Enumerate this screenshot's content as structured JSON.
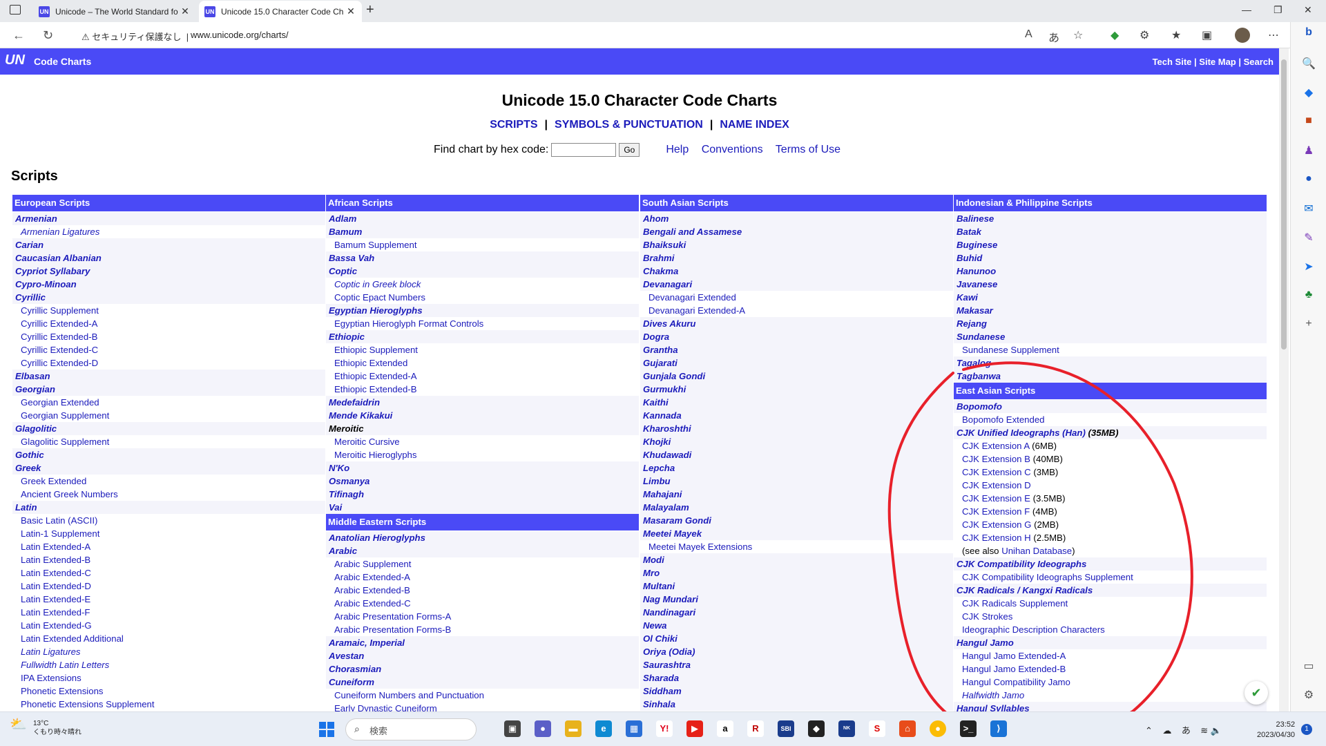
{
  "browser": {
    "tabs": [
      {
        "title": "Unicode – The World Standard fo"
      },
      {
        "title": "Unicode 15.0 Character Code Ch"
      }
    ],
    "security_label": "セキュリティ保護なし",
    "url": "www.unicode.org/charts/"
  },
  "site": {
    "logo": "UN",
    "section": "Code Charts",
    "links": [
      "Tech Site",
      "Site Map",
      "Search"
    ]
  },
  "page": {
    "title": "Unicode 15.0 Character Code Charts",
    "nav": [
      "SCRIPTS",
      "SYMBOLS & PUNCTUATION",
      "NAME INDEX"
    ],
    "find_label": "Find chart by hex code:",
    "go_label": "Go",
    "help_links": [
      "Help",
      "Conventions",
      "Terms of Use"
    ],
    "scripts_heading": "Scripts"
  },
  "columns": [
    {
      "sections": [
        {
          "header": "European Scripts",
          "items": [
            {
              "t": "Armenian",
              "k": "b"
            },
            {
              "t": "Armenian Ligatures",
              "k": "si"
            },
            {
              "t": "Carian",
              "k": "b"
            },
            {
              "t": "Caucasian Albanian",
              "k": "b"
            },
            {
              "t": "Cypriot Syllabary",
              "k": "b"
            },
            {
              "t": "Cypro-Minoan",
              "k": "b"
            },
            {
              "t": "Cyrillic",
              "k": "b"
            },
            {
              "t": "Cyrillic Supplement",
              "k": "s"
            },
            {
              "t": "Cyrillic Extended-A",
              "k": "s"
            },
            {
              "t": "Cyrillic Extended-B",
              "k": "s"
            },
            {
              "t": "Cyrillic Extended-C",
              "k": "s"
            },
            {
              "t": "Cyrillic Extended-D",
              "k": "s"
            },
            {
              "t": "Elbasan",
              "k": "b"
            },
            {
              "t": "Georgian",
              "k": "b"
            },
            {
              "t": "Georgian Extended",
              "k": "s"
            },
            {
              "t": "Georgian Supplement",
              "k": "s"
            },
            {
              "t": "Glagolitic",
              "k": "b"
            },
            {
              "t": "Glagolitic Supplement",
              "k": "s"
            },
            {
              "t": "Gothic",
              "k": "b"
            },
            {
              "t": "Greek",
              "k": "b"
            },
            {
              "t": "Greek Extended",
              "k": "s"
            },
            {
              "t": "Ancient Greek Numbers",
              "k": "s"
            },
            {
              "t": "Latin",
              "k": "b"
            },
            {
              "t": "Basic Latin (ASCII)",
              "k": "s"
            },
            {
              "t": "Latin-1 Supplement",
              "k": "s"
            },
            {
              "t": "Latin Extended-A",
              "k": "s"
            },
            {
              "t": "Latin Extended-B",
              "k": "s"
            },
            {
              "t": "Latin Extended-C",
              "k": "s"
            },
            {
              "t": "Latin Extended-D",
              "k": "s"
            },
            {
              "t": "Latin Extended-E",
              "k": "s"
            },
            {
              "t": "Latin Extended-F",
              "k": "s"
            },
            {
              "t": "Latin Extended-G",
              "k": "s"
            },
            {
              "t": "Latin Extended Additional",
              "k": "s"
            },
            {
              "t": "Latin Ligatures",
              "k": "si"
            },
            {
              "t": "Fullwidth Latin Letters",
              "k": "si"
            },
            {
              "t": "IPA Extensions",
              "k": "s"
            },
            {
              "t": "Phonetic Extensions",
              "k": "s"
            },
            {
              "t": "Phonetic Extensions Supplement",
              "k": "s"
            }
          ]
        }
      ]
    },
    {
      "sections": [
        {
          "header": "African Scripts",
          "items": [
            {
              "t": "Adlam",
              "k": "b"
            },
            {
              "t": "Bamum",
              "k": "b"
            },
            {
              "t": "Bamum Supplement",
              "k": "s"
            },
            {
              "t": "Bassa Vah",
              "k": "b"
            },
            {
              "t": "Coptic",
              "k": "b"
            },
            {
              "t": "Coptic in Greek block",
              "k": "si"
            },
            {
              "t": "Coptic Epact Numbers",
              "k": "s"
            },
            {
              "t": "Egyptian Hieroglyphs",
              "k": "b"
            },
            {
              "t": "Egyptian Hieroglyph Format Controls",
              "k": "s"
            },
            {
              "t": "Ethiopic",
              "k": "b"
            },
            {
              "t": "Ethiopic Supplement",
              "k": "s"
            },
            {
              "t": "Ethiopic Extended",
              "k": "s"
            },
            {
              "t": "Ethiopic Extended-A",
              "k": "s"
            },
            {
              "t": "Ethiopic Extended-B",
              "k": "s"
            },
            {
              "t": "Medefaidrin",
              "k": "b"
            },
            {
              "t": "Mende Kikakui",
              "k": "b"
            },
            {
              "t": "Meroitic",
              "k": "bk"
            },
            {
              "t": "Meroitic Cursive",
              "k": "s"
            },
            {
              "t": "Meroitic Hieroglyphs",
              "k": "s"
            },
            {
              "t": "N'Ko",
              "k": "b"
            },
            {
              "t": "Osmanya",
              "k": "b"
            },
            {
              "t": "Tifinagh",
              "k": "b"
            },
            {
              "t": "Vai",
              "k": "b"
            }
          ]
        },
        {
          "header": "Middle Eastern Scripts",
          "items": [
            {
              "t": "Anatolian Hieroglyphs",
              "k": "b"
            },
            {
              "t": "Arabic",
              "k": "b"
            },
            {
              "t": "Arabic Supplement",
              "k": "s"
            },
            {
              "t": "Arabic Extended-A",
              "k": "s"
            },
            {
              "t": "Arabic Extended-B",
              "k": "s"
            },
            {
              "t": "Arabic Extended-C",
              "k": "s"
            },
            {
              "t": "Arabic Presentation Forms-A",
              "k": "s"
            },
            {
              "t": "Arabic Presentation Forms-B",
              "k": "s"
            },
            {
              "t": "Aramaic, Imperial",
              "k": "b"
            },
            {
              "t": "Avestan",
              "k": "b"
            },
            {
              "t": "Chorasmian",
              "k": "b"
            },
            {
              "t": "Cuneiform",
              "k": "b"
            },
            {
              "t": "Cuneiform Numbers and Punctuation",
              "k": "s"
            },
            {
              "t": "Early Dynastic Cuneiform",
              "k": "s"
            }
          ]
        }
      ]
    },
    {
      "sections": [
        {
          "header": "South Asian Scripts",
          "items": [
            {
              "t": "Ahom",
              "k": "b"
            },
            {
              "t": "Bengali and Assamese",
              "k": "b"
            },
            {
              "t": "Bhaiksuki",
              "k": "b"
            },
            {
              "t": "Brahmi",
              "k": "b"
            },
            {
              "t": "Chakma",
              "k": "b"
            },
            {
              "t": "Devanagari",
              "k": "b"
            },
            {
              "t": "Devanagari Extended",
              "k": "s"
            },
            {
              "t": "Devanagari Extended-A",
              "k": "s"
            },
            {
              "t": "Dives Akuru",
              "k": "b"
            },
            {
              "t": "Dogra",
              "k": "b"
            },
            {
              "t": "Grantha",
              "k": "b"
            },
            {
              "t": "Gujarati",
              "k": "b"
            },
            {
              "t": "Gunjala Gondi",
              "k": "b"
            },
            {
              "t": "Gurmukhi",
              "k": "b"
            },
            {
              "t": "Kaithi",
              "k": "b"
            },
            {
              "t": "Kannada",
              "k": "b"
            },
            {
              "t": "Kharoshthi",
              "k": "b"
            },
            {
              "t": "Khojki",
              "k": "b"
            },
            {
              "t": "Khudawadi",
              "k": "b"
            },
            {
              "t": "Lepcha",
              "k": "b"
            },
            {
              "t": "Limbu",
              "k": "b"
            },
            {
              "t": "Mahajani",
              "k": "b"
            },
            {
              "t": "Malayalam",
              "k": "b"
            },
            {
              "t": "Masaram Gondi",
              "k": "b"
            },
            {
              "t": "Meetei Mayek",
              "k": "b"
            },
            {
              "t": "Meetei Mayek Extensions",
              "k": "s"
            },
            {
              "t": "Modi",
              "k": "b"
            },
            {
              "t": "Mro",
              "k": "b"
            },
            {
              "t": "Multani",
              "k": "b"
            },
            {
              "t": "Nag Mundari",
              "k": "b"
            },
            {
              "t": "Nandinagari",
              "k": "b"
            },
            {
              "t": "Newa",
              "k": "b"
            },
            {
              "t": "Ol Chiki",
              "k": "b"
            },
            {
              "t": "Oriya (Odia)",
              "k": "b"
            },
            {
              "t": "Saurashtra",
              "k": "b"
            },
            {
              "t": "Sharada",
              "k": "b"
            },
            {
              "t": "Siddham",
              "k": "b"
            },
            {
              "t": "Sinhala",
              "k": "b"
            }
          ]
        }
      ]
    },
    {
      "sections": [
        {
          "header": "Indonesian & Philippine Scripts",
          "items": [
            {
              "t": "Balinese",
              "k": "b"
            },
            {
              "t": "Batak",
              "k": "b"
            },
            {
              "t": "Buginese",
              "k": "b"
            },
            {
              "t": "Buhid",
              "k": "b"
            },
            {
              "t": "Hanunoo",
              "k": "b"
            },
            {
              "t": "Javanese",
              "k": "b"
            },
            {
              "t": "Kawi",
              "k": "b"
            },
            {
              "t": "Makasar",
              "k": "b"
            },
            {
              "t": "Rejang",
              "k": "b"
            },
            {
              "t": "Sundanese",
              "k": "b"
            },
            {
              "t": "Sundanese Supplement",
              "k": "s"
            },
            {
              "t": "Tagalog",
              "k": "b"
            },
            {
              "t": "Tagbanwa",
              "k": "b"
            }
          ]
        },
        {
          "header": "East Asian Scripts",
          "items": [
            {
              "t": "Bopomofo",
              "k": "b"
            },
            {
              "t": "Bopomofo Extended",
              "k": "s"
            },
            {
              "t": "CJK Unified Ideographs (Han)",
              "k": "b",
              "extra": " (35MB)"
            },
            {
              "t": "CJK Extension A",
              "k": "s",
              "extra": " (6MB)"
            },
            {
              "t": "CJK Extension B",
              "k": "s",
              "extra": " (40MB)"
            },
            {
              "t": "CJK Extension C",
              "k": "s",
              "extra": " (3MB)"
            },
            {
              "t": "CJK Extension D",
              "k": "s"
            },
            {
              "t": "CJK Extension E",
              "k": "s",
              "extra": " (3.5MB)"
            },
            {
              "t": "CJK Extension F",
              "k": "s",
              "extra": " (4MB)"
            },
            {
              "t": "CJK Extension G",
              "k": "s",
              "extra": " (2MB)"
            },
            {
              "t": "CJK Extension H",
              "k": "s",
              "extra": " (2.5MB)"
            },
            {
              "t": "Unihan Database",
              "k": "s",
              "pre": "(see also ",
              "extra": ")"
            },
            {
              "t": "CJK Compatibility Ideographs",
              "k": "b"
            },
            {
              "t": "CJK Compatibility Ideographs Supplement",
              "k": "s"
            },
            {
              "t": "CJK Radicals / Kangxi Radicals",
              "k": "b"
            },
            {
              "t": "CJK Radicals Supplement",
              "k": "s"
            },
            {
              "t": "CJK Strokes",
              "k": "s"
            },
            {
              "t": "Ideographic Description Characters",
              "k": "s"
            },
            {
              "t": "Hangul Jamo",
              "k": "b"
            },
            {
              "t": "Hangul Jamo Extended-A",
              "k": "s"
            },
            {
              "t": "Hangul Jamo Extended-B",
              "k": "s"
            },
            {
              "t": "Hangul Compatibility Jamo",
              "k": "s"
            },
            {
              "t": "Halfwidth Jamo",
              "k": "si"
            },
            {
              "t": "Hangul Syllables",
              "k": "b"
            }
          ]
        }
      ]
    }
  ],
  "taskbar": {
    "temperature": "13°C",
    "weather": "くもり時々晴れ",
    "search_placeholder": "検索",
    "time": "23:52",
    "date": "2023/04/30",
    "notifications": "1",
    "ime": "あ"
  },
  "colors": {
    "accent": "#4a4af6",
    "link": "#1b1bbb",
    "annotation": "#e8202a"
  }
}
